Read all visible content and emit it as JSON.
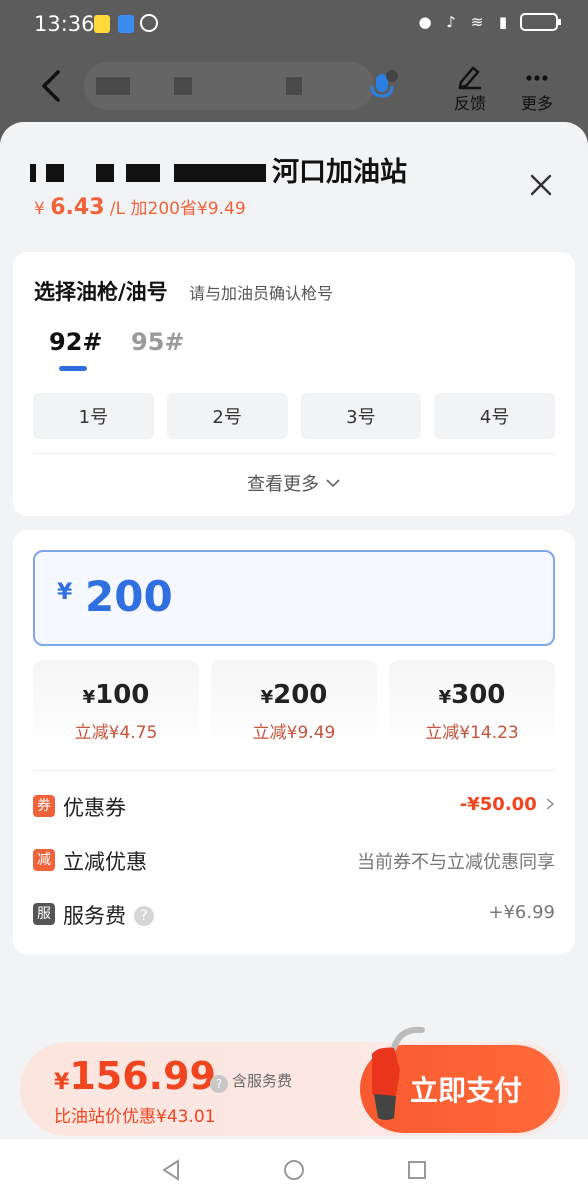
{
  "status_bar": {
    "time": "13:36"
  },
  "nav": {
    "feedback_label": "反馈",
    "more_label": "更多"
  },
  "station": {
    "name": "河口加油站",
    "price_prefix": "¥",
    "price": "6.43",
    "price_unit": "/L",
    "promo": "加200省¥9.49"
  },
  "gun_select": {
    "title": "选择油枪/油号",
    "subtitle": "请与加油员确认枪号",
    "fuel_tabs": [
      "92#",
      "95#"
    ],
    "guns": [
      "1号",
      "2号",
      "3号",
      "4号"
    ],
    "more": "查看更多"
  },
  "amount": {
    "currency": "¥",
    "value": "200",
    "presets": [
      {
        "yen": "¥",
        "amount": "100",
        "discount": "立减¥4.75"
      },
      {
        "yen": "¥",
        "amount": "200",
        "discount": "立减¥9.49"
      },
      {
        "yen": "¥",
        "amount": "300",
        "discount": "立减¥14.23"
      }
    ]
  },
  "rows": {
    "coupon": {
      "badge": "券",
      "label": "优惠券",
      "value": "-¥50.00"
    },
    "discount": {
      "badge": "减",
      "label": "立减优惠",
      "value": "当前券不与立减优惠同享"
    },
    "service": {
      "badge": "服",
      "label": "服务费",
      "value": "+¥6.99"
    }
  },
  "pay": {
    "currency": "¥",
    "total": "156.99",
    "includes": "含服务费",
    "saving": "比油站价优惠¥43.01",
    "button": "立即支付"
  },
  "colors": {
    "accent_blue": "#2f6fe0",
    "accent_orange": "#f0451f",
    "badge_orange": "#f0633a",
    "badge_gray": "#555555"
  }
}
